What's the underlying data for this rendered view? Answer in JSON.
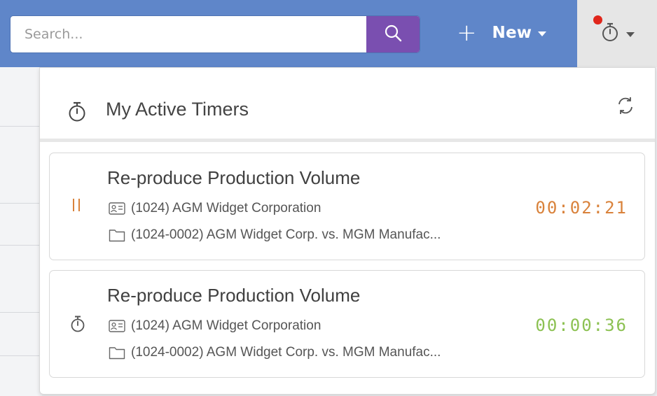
{
  "search": {
    "placeholder": "Search..."
  },
  "header": {
    "new_plus": "+",
    "new_label": "New"
  },
  "panel": {
    "title": "My Active Timers"
  },
  "timers": [
    {
      "title": "Re-produce Production Volume",
      "client": "(1024) AGM Widget Corporation",
      "matter": "(1024-0002) AGM Widget Corp. vs. MGM Manufac...",
      "time": "00:02:21",
      "state_icon": "pause-icon",
      "time_color": "#d9823b"
    },
    {
      "title": "Re-produce Production Volume",
      "client": "(1024) AGM Widget Corporation",
      "matter": "(1024-0002) AGM Widget Corp. vs. MGM Manufac...",
      "time": "00:00:36",
      "state_icon": "stopwatch-icon",
      "time_color": "#8cc152"
    }
  ],
  "colors": {
    "topbar": "#5f86c9",
    "search_button": "#7a4fb0",
    "notification": "#e0261b"
  }
}
